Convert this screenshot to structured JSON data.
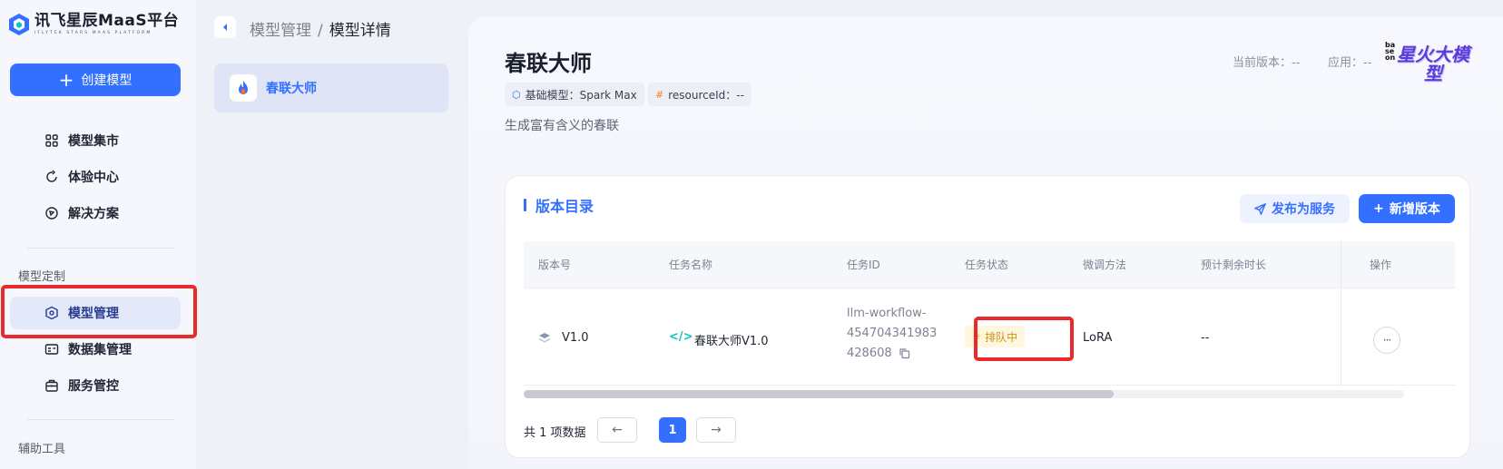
{
  "sidebar": {
    "logo_title": "讯飞星辰MaaS平台",
    "logo_subtitle": "IFLYTEK STARS MAAS PLATFORM",
    "create_label": "创建模型",
    "items": [
      {
        "label": "模型集市",
        "icon": "grid-icon"
      },
      {
        "label": "体验中心",
        "icon": "refresh-icon"
      },
      {
        "label": "解决方案",
        "icon": "compass-icon"
      }
    ],
    "group_custom": "模型定制",
    "custom_items": [
      {
        "label": "模型管理",
        "icon": "cube-icon",
        "active": true
      },
      {
        "label": "数据集管理",
        "icon": "dataset-icon"
      },
      {
        "label": "服务管控",
        "icon": "briefcase-icon"
      }
    ],
    "group_tools": "辅助工具"
  },
  "breadcrumb": {
    "parent": "模型管理",
    "separator": "/",
    "current": "模型详情"
  },
  "model_list": [
    {
      "label": "春联大师"
    }
  ],
  "detail": {
    "title": "春联大师",
    "tag_base": "基础模型：Spark Max",
    "tag_resource": "resourceId：--",
    "description": "生成富有含义的春联",
    "current_version": "当前版本：--",
    "application": "应用：--",
    "badge_base": "base on",
    "badge_text": "星火大模型"
  },
  "versions": {
    "title": "版本目录",
    "publish_label": "发布为服务",
    "new_label": "新增版本",
    "columns": [
      "版本号",
      "任务名称",
      "任务ID",
      "任务状态",
      "微调方法",
      "预计剩余时长",
      "操作"
    ],
    "rows": [
      {
        "version": "V1.0",
        "task_name": "春联大师V1.0",
        "task_id_line1": "llm-workflow-",
        "task_id_line2": "454704341983",
        "task_id_line3": "428608",
        "status": "排队中",
        "method": "LoRA",
        "remaining": "--",
        "more": "···"
      }
    ],
    "scroll_fraction": 0.67,
    "total": "共 1 项数据",
    "current_page": "1",
    "prev": "←",
    "next": "→"
  },
  "colors": {
    "accent": "#3370ff",
    "highlight_box": "#ea2a2a",
    "status_queue": "#c8931a"
  }
}
